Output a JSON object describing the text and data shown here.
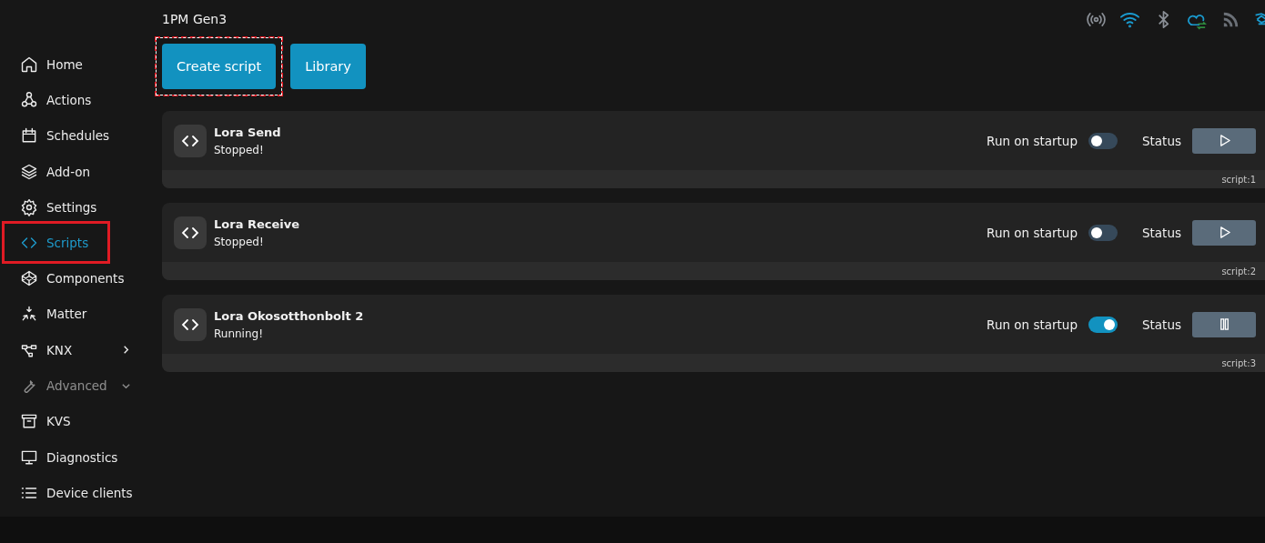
{
  "device_title": "1PM Gen3",
  "sidebar": {
    "items": [
      {
        "label": "Home",
        "kind": "link",
        "selected": false,
        "disabled": false,
        "highlighted": false
      },
      {
        "label": "Actions",
        "kind": "link",
        "selected": false,
        "disabled": false,
        "highlighted": false
      },
      {
        "label": "Schedules",
        "kind": "link",
        "selected": false,
        "disabled": false,
        "highlighted": false
      },
      {
        "label": "Add-on",
        "kind": "link",
        "selected": false,
        "disabled": false,
        "highlighted": false
      },
      {
        "label": "Settings",
        "kind": "link",
        "selected": false,
        "disabled": false,
        "highlighted": false
      },
      {
        "label": "Scripts",
        "kind": "link",
        "selected": true,
        "disabled": false,
        "highlighted": true
      },
      {
        "label": "Components",
        "kind": "link",
        "selected": false,
        "disabled": false,
        "highlighted": false
      },
      {
        "label": "Matter",
        "kind": "link",
        "selected": false,
        "disabled": false,
        "highlighted": false
      },
      {
        "label": "KNX",
        "kind": "group",
        "expanded": false,
        "selected": false,
        "disabled": false,
        "highlighted": false
      },
      {
        "label": "Advanced",
        "kind": "group",
        "expanded": true,
        "selected": false,
        "disabled": true,
        "highlighted": false
      },
      {
        "label": "KVS",
        "kind": "link",
        "selected": false,
        "disabled": false,
        "highlighted": false
      },
      {
        "label": "Diagnostics",
        "kind": "link",
        "selected": false,
        "disabled": false,
        "highlighted": false
      },
      {
        "label": "Device clients",
        "kind": "link",
        "selected": false,
        "disabled": false,
        "highlighted": false
      }
    ]
  },
  "toolbar": {
    "buttons": [
      {
        "label": "Create script",
        "highlighted": true
      },
      {
        "label": "Library",
        "highlighted": false
      }
    ]
  },
  "scripts": [
    {
      "name": "Lora Send",
      "status": "Stopped!",
      "startup_label": "Run on startup",
      "run_on_startup": false,
      "status_label": "Status",
      "running": false,
      "id": "script:1"
    },
    {
      "name": "Lora Receive",
      "status": "Stopped!",
      "startup_label": "Run on startup",
      "run_on_startup": false,
      "status_label": "Status",
      "running": false,
      "id": "script:2"
    },
    {
      "name": "Lora Okosotthonbolt 2",
      "status": "Running!",
      "startup_label": "Run on startup",
      "run_on_startup": true,
      "status_label": "Status",
      "running": true,
      "id": "script:3"
    }
  ]
}
